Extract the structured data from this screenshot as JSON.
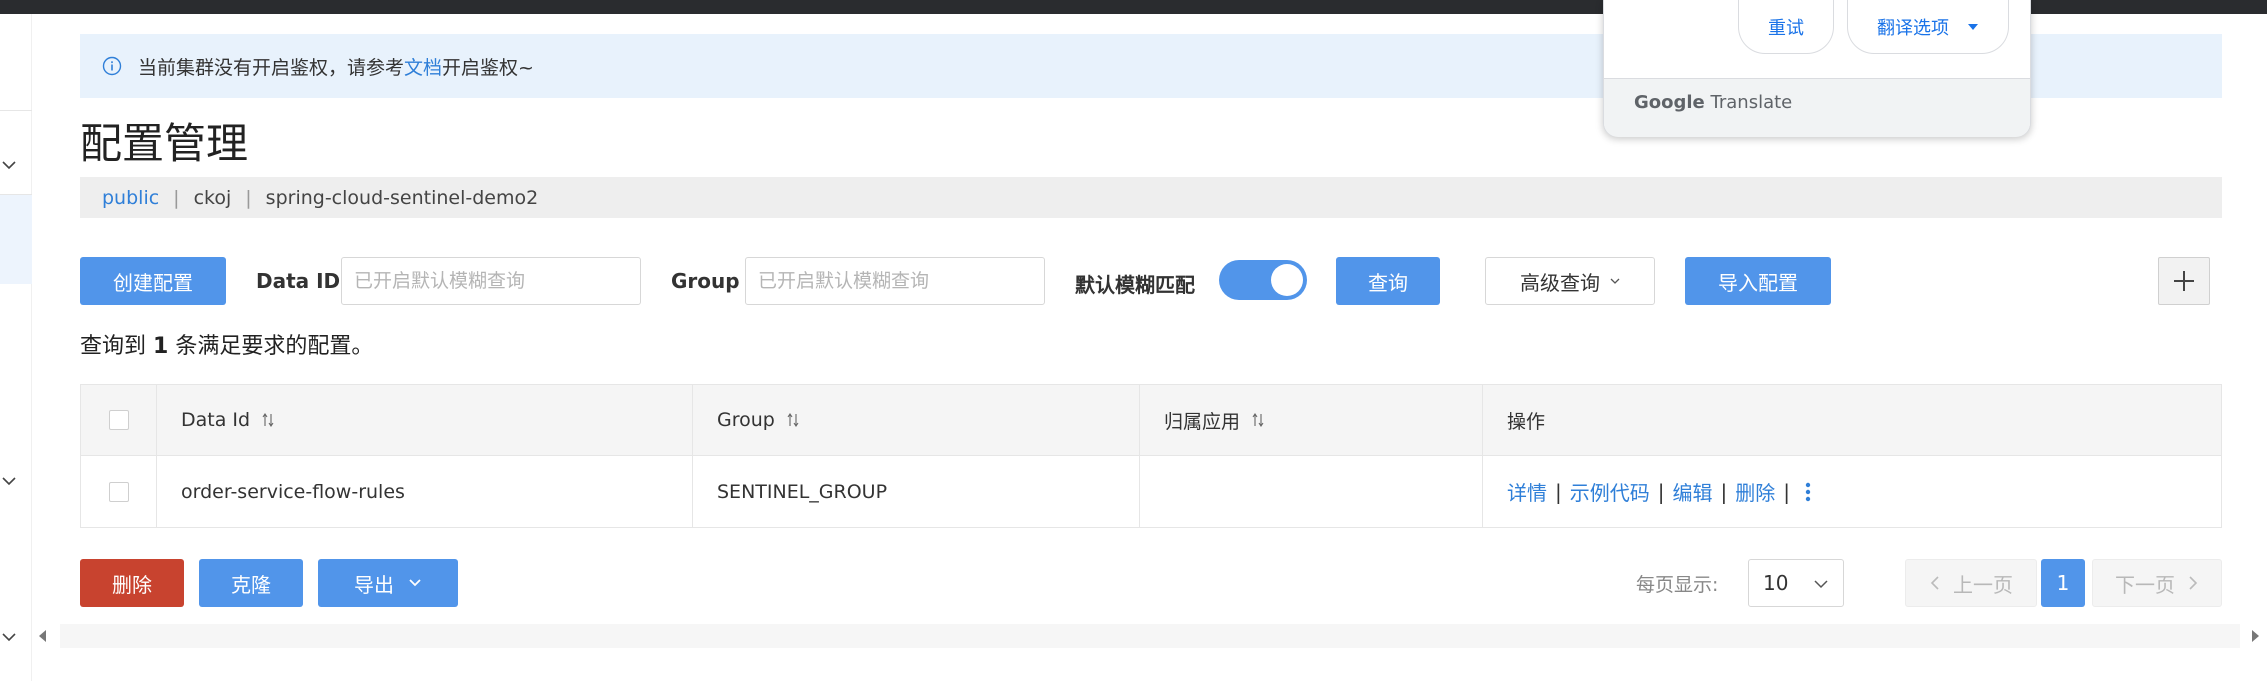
{
  "notice": {
    "text_before": "当前集群没有开启鉴权，请参考",
    "link": "文档",
    "text_after": "开启鉴权~"
  },
  "page_title": "配置管理",
  "breadcrumb": {
    "namespace": "public",
    "item2": "ckoj",
    "item3": "spring-cloud-sentinel-demo2"
  },
  "toolbar": {
    "create_label": "创建配置",
    "dataid_label": "Data ID",
    "dataid_placeholder": "已开启默认模糊查询",
    "group_label": "Group",
    "group_placeholder": "已开启默认模糊查询",
    "fuzzy_label": "默认模糊匹配",
    "fuzzy_on": true,
    "query_label": "查询",
    "advanced_label": "高级查询",
    "import_label": "导入配置"
  },
  "result": {
    "prefix": "查询到",
    "count": "1",
    "suffix": "条满足要求的配置。"
  },
  "table": {
    "headers": {
      "data_id": "Data Id",
      "group": "Group",
      "app": "归属应用",
      "actions": "操作"
    },
    "rows": [
      {
        "data_id": "order-service-flow-rules",
        "group": "SENTINEL_GROUP",
        "app": ""
      }
    ],
    "actions": {
      "detail": "详情",
      "sample": "示例代码",
      "edit": "编辑",
      "delete": "删除",
      "sep": "|"
    }
  },
  "footer": {
    "delete_label": "删除",
    "clone_label": "克隆",
    "export_label": "导出",
    "page_size_label": "每页显示:",
    "page_size": "10",
    "prev_label": "上一页",
    "current_page": "1",
    "next_label": "下一页"
  },
  "translate_popup": {
    "retry_label": "重试",
    "options_label": "翻译选项",
    "brand_google": "Google",
    "brand_translate": "Translate"
  },
  "colors": {
    "primary": "#5195ea",
    "danger": "#c8432f",
    "link": "#2f7fd8",
    "notice_bg": "#e8f2fc"
  }
}
